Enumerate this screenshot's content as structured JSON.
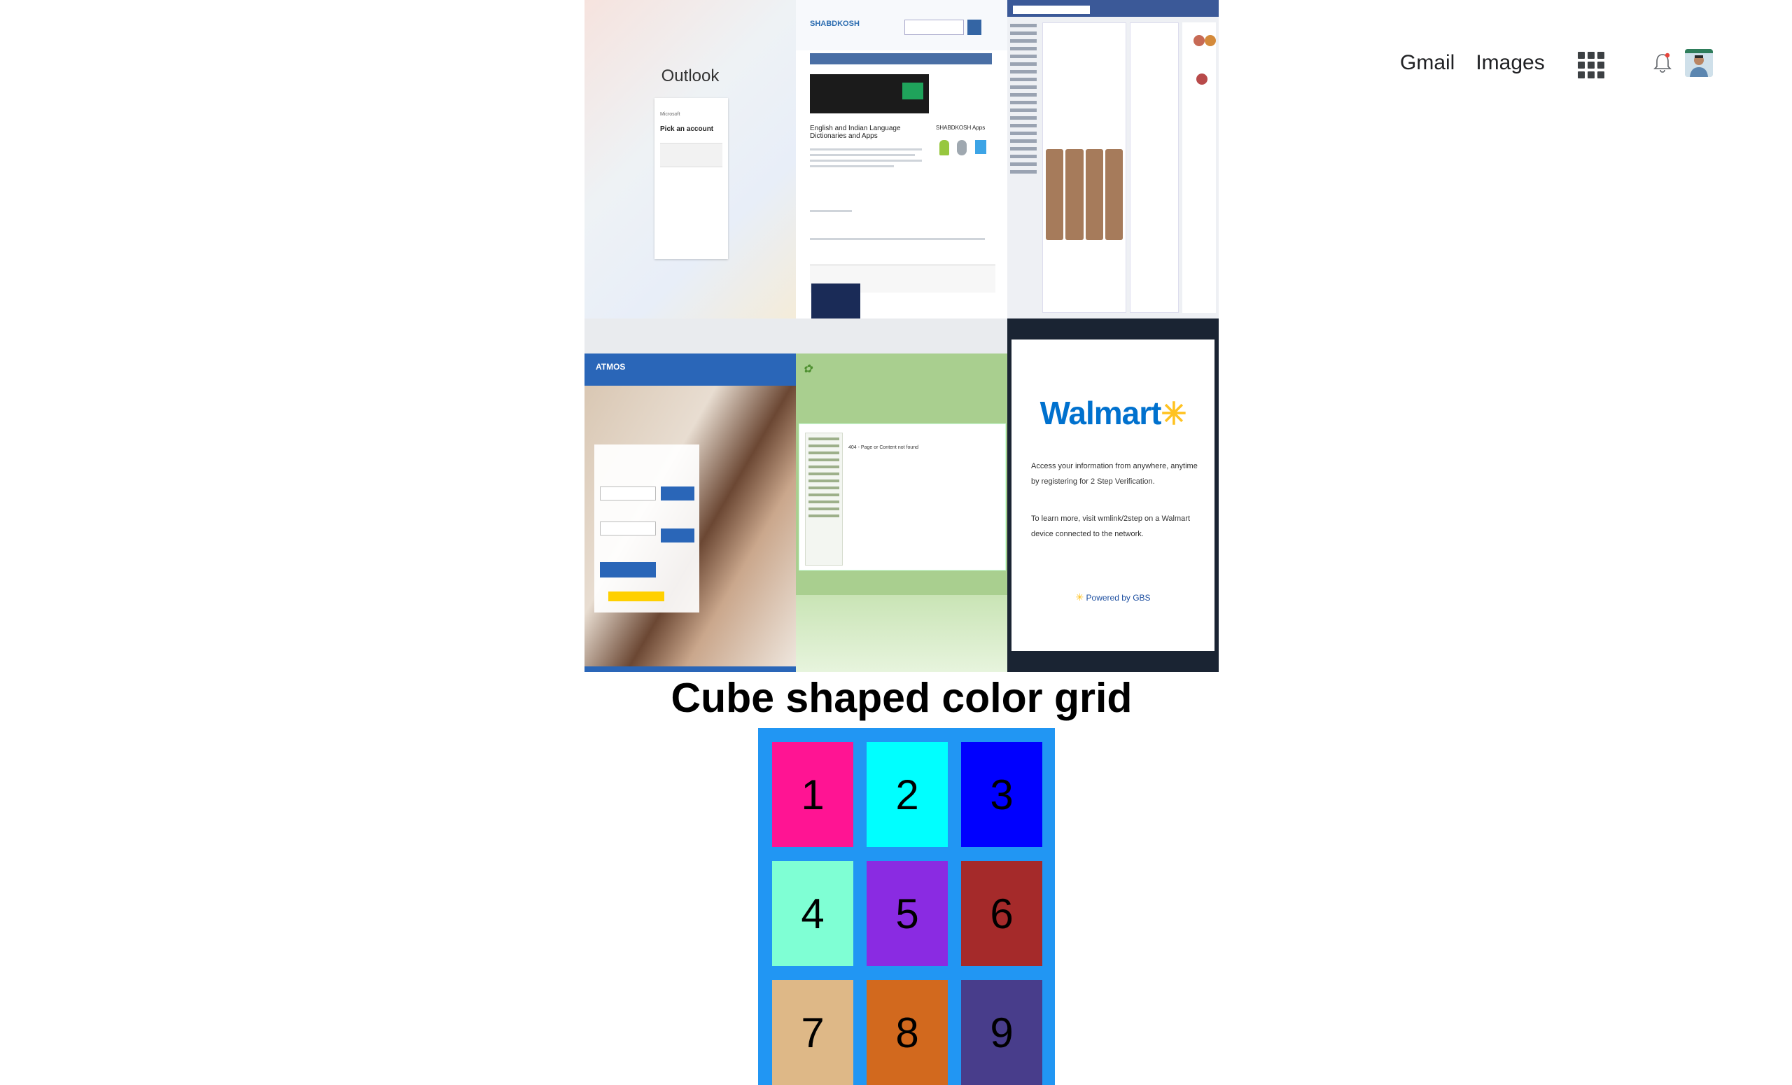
{
  "header": {
    "gmail_label": "Gmail",
    "images_label": "Images"
  },
  "thumbnails": {
    "outlook": {
      "title": "Outlook",
      "card_brand": "Microsoft",
      "card_heading": "Pick an account"
    },
    "shabdkosh": {
      "brand": "SHABDKOSH",
      "heading": "English and Indian Language Dictionaries and Apps",
      "apps_heading": "SHABDKOSH Apps"
    },
    "atmos": {
      "logo": "ATMOS"
    },
    "sparkster": {
      "message": "404 - Page or Content not found"
    },
    "walmart": {
      "logo": "Walmart",
      "paragraph_1": "Access your information from anywhere, anytime by registering for 2 Step Verification.",
      "paragraph_2": "To learn more, visit wmlink/2step on a Walmart device connected to the network.",
      "powered_by": "Powered by GBS"
    }
  },
  "grid": {
    "title": "Cube shaped color grid",
    "border_color": "#2196f3",
    "cells": [
      {
        "label": "1",
        "color": "#ff1493"
      },
      {
        "label": "2",
        "color": "#00ffff"
      },
      {
        "label": "3",
        "color": "#0000ff"
      },
      {
        "label": "4",
        "color": "#7fffd4"
      },
      {
        "label": "5",
        "color": "#8a2be2"
      },
      {
        "label": "6",
        "color": "#a52a2a"
      },
      {
        "label": "7",
        "color": "#deb887"
      },
      {
        "label": "8",
        "color": "#d2691e"
      },
      {
        "label": "9",
        "color": "#483d8b"
      }
    ]
  },
  "icons": {
    "apps": "apps-grid-icon",
    "notifications": "bell-icon",
    "profile": "avatar"
  }
}
